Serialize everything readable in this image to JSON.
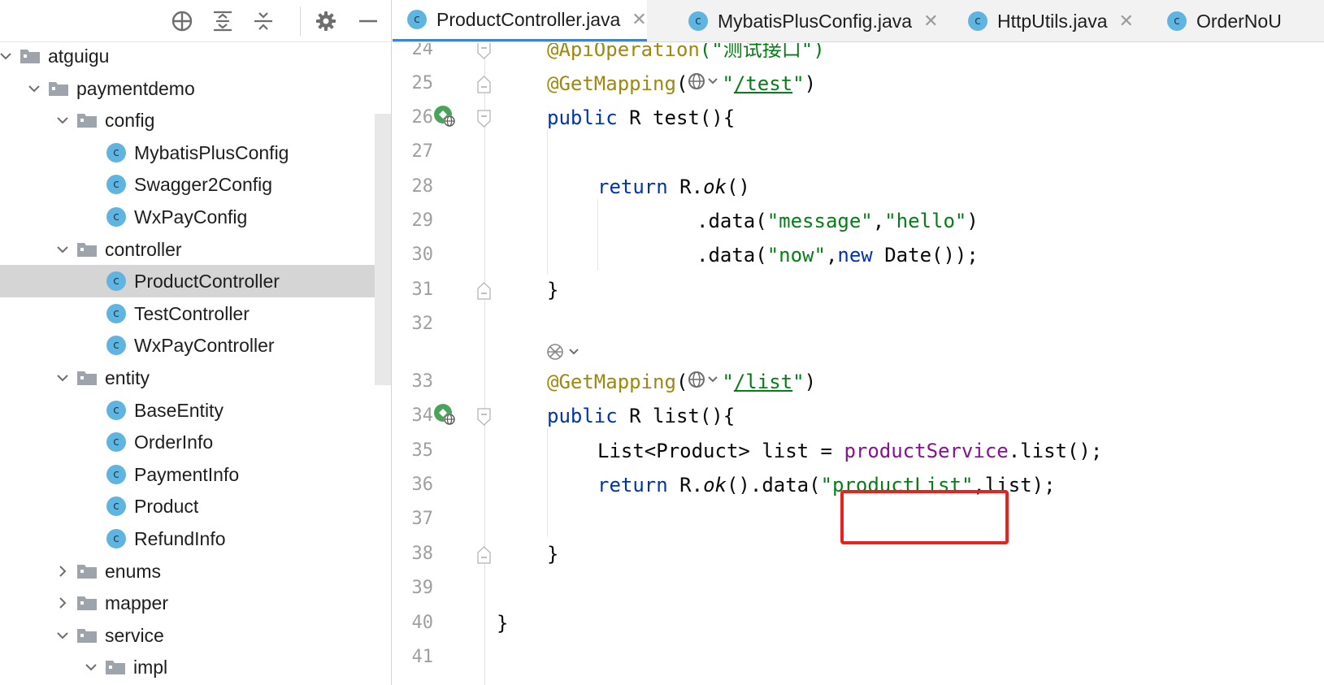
{
  "project_panel": {
    "toolbar_icons": [
      "locate-icon",
      "expand-all-icon",
      "collapse-all-icon",
      "gear-icon",
      "hide-icon"
    ],
    "tree": [
      {
        "label": "atguigu",
        "type": "folder",
        "level": 0,
        "expanded": true
      },
      {
        "label": "paymentdemo",
        "type": "folder",
        "level": 1,
        "expanded": true
      },
      {
        "label": "config",
        "type": "folder",
        "level": 2,
        "expanded": true
      },
      {
        "label": "MybatisPlusConfig",
        "type": "class",
        "level": 3
      },
      {
        "label": "Swagger2Config",
        "type": "class",
        "level": 3
      },
      {
        "label": "WxPayConfig",
        "type": "class",
        "level": 3
      },
      {
        "label": "controller",
        "type": "folder",
        "level": 2,
        "expanded": true
      },
      {
        "label": "ProductController",
        "type": "class",
        "level": 3,
        "selected": true
      },
      {
        "label": "TestController",
        "type": "class",
        "level": 3
      },
      {
        "label": "WxPayController",
        "type": "class",
        "level": 3
      },
      {
        "label": "entity",
        "type": "folder",
        "level": 2,
        "expanded": true
      },
      {
        "label": "BaseEntity",
        "type": "class",
        "level": 3
      },
      {
        "label": "OrderInfo",
        "type": "class",
        "level": 3
      },
      {
        "label": "PaymentInfo",
        "type": "class",
        "level": 3
      },
      {
        "label": "Product",
        "type": "class",
        "level": 3
      },
      {
        "label": "RefundInfo",
        "type": "class",
        "level": 3
      },
      {
        "label": "enums",
        "type": "folder",
        "level": 2,
        "expanded": false
      },
      {
        "label": "mapper",
        "type": "folder",
        "level": 2,
        "expanded": false
      },
      {
        "label": "service",
        "type": "folder",
        "level": 2,
        "expanded": true
      },
      {
        "label": "impl",
        "type": "folder",
        "level": 3,
        "expanded": true
      }
    ]
  },
  "tabs": [
    {
      "label": "ProductController.java",
      "icon": "c",
      "active": true
    },
    {
      "label": "MybatisPlusConfig.java",
      "icon": "c"
    },
    {
      "label": "HttpUtils.java",
      "icon": "c"
    },
    {
      "label": "OrderNoU",
      "icon": "c"
    }
  ],
  "tab_close_glyph": "✕",
  "class_icon_letter": "c",
  "editor": {
    "line_numbers": [
      "24",
      "25",
      "26",
      "27",
      "28",
      "29",
      "30",
      "31",
      "32",
      "33",
      "34",
      "35",
      "36",
      "37",
      "38",
      "39",
      "40",
      "41"
    ],
    "code": {
      "l24_ann": "@ApiOperation",
      "l24_arg": "(\"测试接口\")",
      "l25_ann": "@GetMapping",
      "l25_open": "(",
      "l25_q1": "\"",
      "l25_url": "/test",
      "l25_q2": "\"",
      "l25_close": ")",
      "l26_kw": "public",
      "l26_rest": " R test(){",
      "l28_kw": "return",
      "l28_rest1": " R.",
      "l28_ok": "ok",
      "l28_rest2": "()",
      "l29_a": ".data(",
      "l29_s1": "\"message\"",
      "l29_comma": ",",
      "l29_s2": "\"hello\"",
      "l29_b": ")",
      "l30_a": ".data(",
      "l30_s1": "\"now\"",
      "l30_comma": ",",
      "l30_kw": "new",
      "l30_b": " Date());",
      "l31": "}",
      "l33_ann": "@GetMapping",
      "l33_open": "(",
      "l33_q1": "\"",
      "l33_url": "/list",
      "l33_q2": "\"",
      "l33_close": ")",
      "l34_kw": "public",
      "l34_rest": " R list(){",
      "l35_a": "List<Product> list = ",
      "l35_fld": "productService",
      "l35_b": ".list();",
      "l36_kw": "return",
      "l36_a": " R.",
      "l36_ok": "ok",
      "l36_b": "().data(",
      "l36_str": "\"productList\"",
      "l36_c": ",list);",
      "l38": "}",
      "l40": "}"
    },
    "highlight_color": "#e8231f"
  },
  "colors": {
    "keyword": "#0033b3",
    "string": "#067d17",
    "annotation": "#9e880d",
    "field": "#871094",
    "selection": "#d5d5d5",
    "class_icon": "#5fb5e0",
    "active_tab_underline": "#4083c9"
  }
}
